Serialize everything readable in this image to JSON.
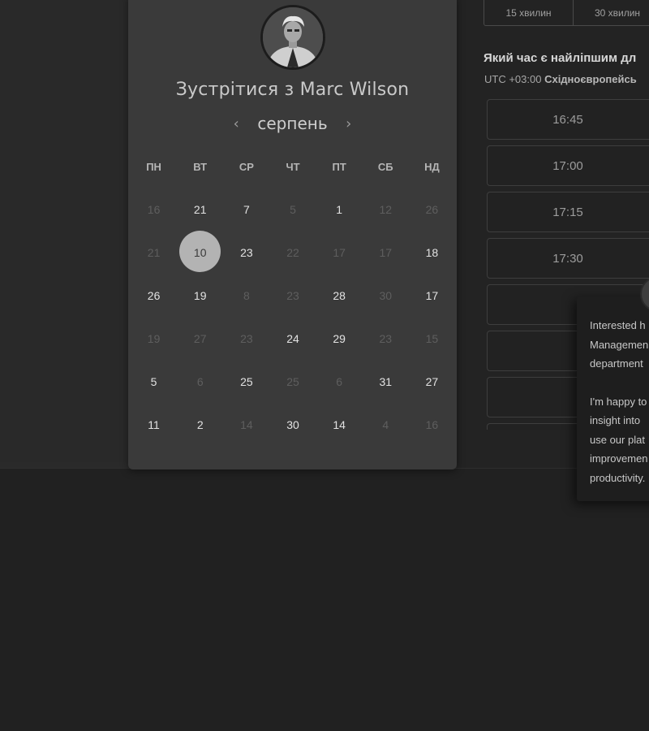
{
  "card": {
    "title": "Зустрітися з Marc Wilson",
    "month": "серпень",
    "prev_icon": "chevron-left-icon",
    "next_icon": "chevron-right-icon"
  },
  "weekdays": [
    "ПН",
    "ВТ",
    "СР",
    "ЧТ",
    "ПТ",
    "СБ",
    "НД"
  ],
  "weeks": [
    [
      {
        "d": "16",
        "a": false
      },
      {
        "d": "21",
        "a": true
      },
      {
        "d": "7",
        "a": true
      },
      {
        "d": "5",
        "a": false
      },
      {
        "d": "1",
        "a": true
      },
      {
        "d": "12",
        "a": false
      },
      {
        "d": "26",
        "a": false
      }
    ],
    [
      {
        "d": "21",
        "a": false
      },
      {
        "d": "10",
        "a": true,
        "s": true
      },
      {
        "d": "23",
        "a": true
      },
      {
        "d": "22",
        "a": false
      },
      {
        "d": "17",
        "a": false
      },
      {
        "d": "17",
        "a": false
      },
      {
        "d": "18",
        "a": true
      }
    ],
    [
      {
        "d": "26",
        "a": true
      },
      {
        "d": "19",
        "a": true
      },
      {
        "d": "8",
        "a": false
      },
      {
        "d": "23",
        "a": false
      },
      {
        "d": "28",
        "a": true
      },
      {
        "d": "30",
        "a": false
      },
      {
        "d": "17",
        "a": true
      }
    ],
    [
      {
        "d": "19",
        "a": false
      },
      {
        "d": "27",
        "a": false
      },
      {
        "d": "23",
        "a": false
      },
      {
        "d": "24",
        "a": true
      },
      {
        "d": "29",
        "a": true
      },
      {
        "d": "23",
        "a": false
      },
      {
        "d": "15",
        "a": false
      }
    ],
    [
      {
        "d": "5",
        "a": true
      },
      {
        "d": "6",
        "a": false
      },
      {
        "d": "25",
        "a": true
      },
      {
        "d": "25",
        "a": false
      },
      {
        "d": "6",
        "a": false
      },
      {
        "d": "31",
        "a": true
      },
      {
        "d": "27",
        "a": true
      }
    ],
    [
      {
        "d": "11",
        "a": true
      },
      {
        "d": "2",
        "a": true
      },
      {
        "d": "14",
        "a": false
      },
      {
        "d": "30",
        "a": true
      },
      {
        "d": "14",
        "a": true
      },
      {
        "d": "4",
        "a": false
      },
      {
        "d": "16",
        "a": false
      }
    ]
  ],
  "durations": [
    "15 хвилин",
    "30 хвилин"
  ],
  "time_question": "Який час є найліпшим дл",
  "timezone": {
    "offset": "UTC +03:00",
    "name": "Східноєвропейсь"
  },
  "slots": [
    "16:45",
    "17:00",
    "17:15",
    "17:30"
  ],
  "popup": {
    "lines": [
      "Interested h",
      "Managemen",
      "department"
    ],
    "lines2": [
      "I'm happy to",
      "insight into",
      "use our plat",
      "improvemen",
      "productivity."
    ]
  }
}
